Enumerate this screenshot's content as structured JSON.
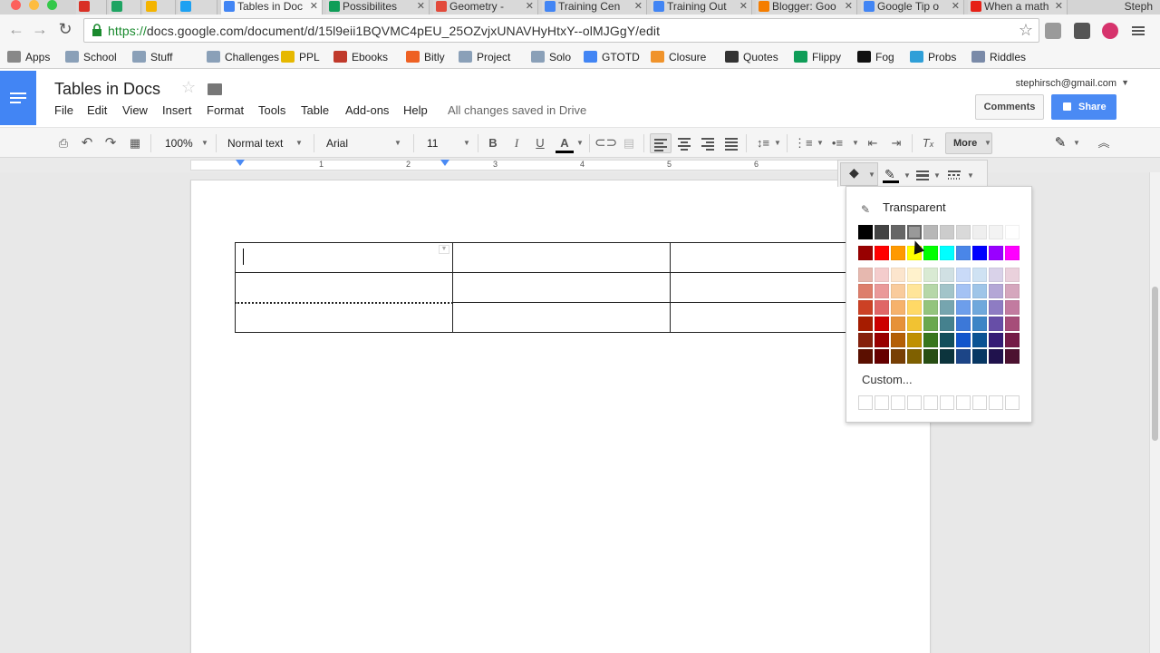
{
  "browser": {
    "tabs": [
      {
        "label": "",
        "icon": "gmail-icon",
        "color": "#d93025"
      },
      {
        "label": "",
        "icon": "drive-icon",
        "color": "#1fa463"
      },
      {
        "label": "",
        "icon": "keep-icon",
        "color": "#f4b400"
      },
      {
        "label": "",
        "icon": "twitter-icon",
        "color": "#1da1f2"
      },
      {
        "label": "Tables in Doc",
        "icon": "docs-icon",
        "color": "#4285f4",
        "active": true
      },
      {
        "label": "Possibilites",
        "icon": "sheets-icon",
        "color": "#0f9d58"
      },
      {
        "label": "Geometry -",
        "icon": "geometry-icon",
        "color": "#e24a3b"
      },
      {
        "label": "Training Cen",
        "icon": "google-icon",
        "color": "#4285f4"
      },
      {
        "label": "Training Out",
        "icon": "docs-icon",
        "color": "#4285f4"
      },
      {
        "label": "Blogger: Goo",
        "icon": "blogger-icon",
        "color": "#f57d00"
      },
      {
        "label": "Google Tip o",
        "icon": "docs-icon",
        "color": "#4285f4"
      },
      {
        "label": "When a math",
        "icon": "youtube-icon",
        "color": "#e62117"
      }
    ],
    "profile_name": "Steph",
    "url_scheme": "https://",
    "url_rest": "docs.google.com/document/d/15l9eii1BQVMC4pEU_25OZvjxUNAVHyHtxY--olMJGgY/edit",
    "bookmarks": [
      {
        "label": "Apps",
        "icon": "apps-grid-icon",
        "color": "#888888"
      },
      {
        "label": "School",
        "icon": "folder-icon",
        "color": "#8aa0b8"
      },
      {
        "label": "Stuff",
        "icon": "folder-icon",
        "color": "#8aa0b8"
      },
      {
        "label": "Challenges",
        "icon": "folder-icon",
        "color": "#8aa0b8"
      },
      {
        "label": "PPL",
        "icon": "ppl-icon",
        "color": "#e6b800"
      },
      {
        "label": "Ebooks",
        "icon": "ebooks-icon",
        "color": "#c0392b"
      },
      {
        "label": "Bitly",
        "icon": "bitly-icon",
        "color": "#ee6123"
      },
      {
        "label": "Project",
        "icon": "folder-icon",
        "color": "#8aa0b8"
      },
      {
        "label": "Solo",
        "icon": "folder-icon",
        "color": "#8aa0b8"
      },
      {
        "label": "GTOTD",
        "icon": "docs-icon",
        "color": "#4285f4"
      },
      {
        "label": "Closure",
        "icon": "edu-icon",
        "color": "#f0932b"
      },
      {
        "label": "Quotes",
        "icon": "tools-icon",
        "color": "#333333"
      },
      {
        "label": "Flippy",
        "icon": "sheets-icon",
        "color": "#0f9d58"
      },
      {
        "label": "Fog",
        "icon": "fog-icon",
        "color": "#111111"
      },
      {
        "label": "Probs",
        "icon": "cc-icon",
        "color": "#2f9fd8"
      },
      {
        "label": "Riddles",
        "icon": "brain-icon",
        "color": "#7a8aa8"
      }
    ]
  },
  "docs": {
    "title": "Tables in Docs",
    "menus": [
      "File",
      "Edit",
      "View",
      "Insert",
      "Format",
      "Tools",
      "Table",
      "Add-ons",
      "Help"
    ],
    "save_status": "All changes saved in Drive",
    "account_email": "stephirsch@gmail.com",
    "comments_label": "Comments",
    "share_label": "Share",
    "brand_color": "#4285f4"
  },
  "toolbar": {
    "zoom": "100%",
    "style": "Normal text",
    "font": "Arial",
    "font_size": "11",
    "bold": "B",
    "italic": "I",
    "underline": "U",
    "text_color": "A",
    "more_label": "More",
    "clear_format": "T"
  },
  "ruler": {
    "numbers": [
      "1",
      "2",
      "3",
      "4",
      "5",
      "6"
    ]
  },
  "table": {
    "rows": 3,
    "cols": 3
  },
  "palette": {
    "transparent_label": "Transparent",
    "custom_label": "Custom...",
    "rows": [
      [
        "#000000",
        "#434343",
        "#666666",
        "#999999",
        "#b7b7b7",
        "#cccccc",
        "#d9d9d9",
        "#efefef",
        "#f3f3f3",
        "#ffffff"
      ],
      [
        "#980000",
        "#ff0000",
        "#ff9900",
        "#ffff00",
        "#00ff00",
        "#00ffff",
        "#4a86e8",
        "#0000ff",
        "#9900ff",
        "#ff00ff"
      ],
      [
        "#e6b8af",
        "#f4cccc",
        "#fce5cd",
        "#fff2cc",
        "#d9ead3",
        "#d0e0e3",
        "#c9daf8",
        "#cfe2f3",
        "#d9d2e9",
        "#ead1dc"
      ],
      [
        "#dd7e6b",
        "#ea9999",
        "#f9cb9c",
        "#ffe599",
        "#b6d7a8",
        "#a2c4c9",
        "#a4c2f4",
        "#9fc5e8",
        "#b4a7d6",
        "#d5a6bd"
      ],
      [
        "#cc4125",
        "#e06666",
        "#f6b26b",
        "#ffd966",
        "#93c47d",
        "#76a5af",
        "#6d9eeb",
        "#6fa8dc",
        "#8e7cc3",
        "#c27ba0"
      ],
      [
        "#a61c00",
        "#cc0000",
        "#e69138",
        "#f1c232",
        "#6aa84f",
        "#45818e",
        "#3c78d8",
        "#3d85c6",
        "#674ea7",
        "#a64d79"
      ],
      [
        "#85200c",
        "#990000",
        "#b45f06",
        "#bf9000",
        "#38761d",
        "#134f5c",
        "#1155cc",
        "#0b5394",
        "#351c75",
        "#741b47"
      ],
      [
        "#5b0f00",
        "#660000",
        "#783f04",
        "#7f6000",
        "#274e13",
        "#0c343d",
        "#1c4587",
        "#073763",
        "#20124d",
        "#4c1130"
      ]
    ],
    "selected": "#999999"
  }
}
